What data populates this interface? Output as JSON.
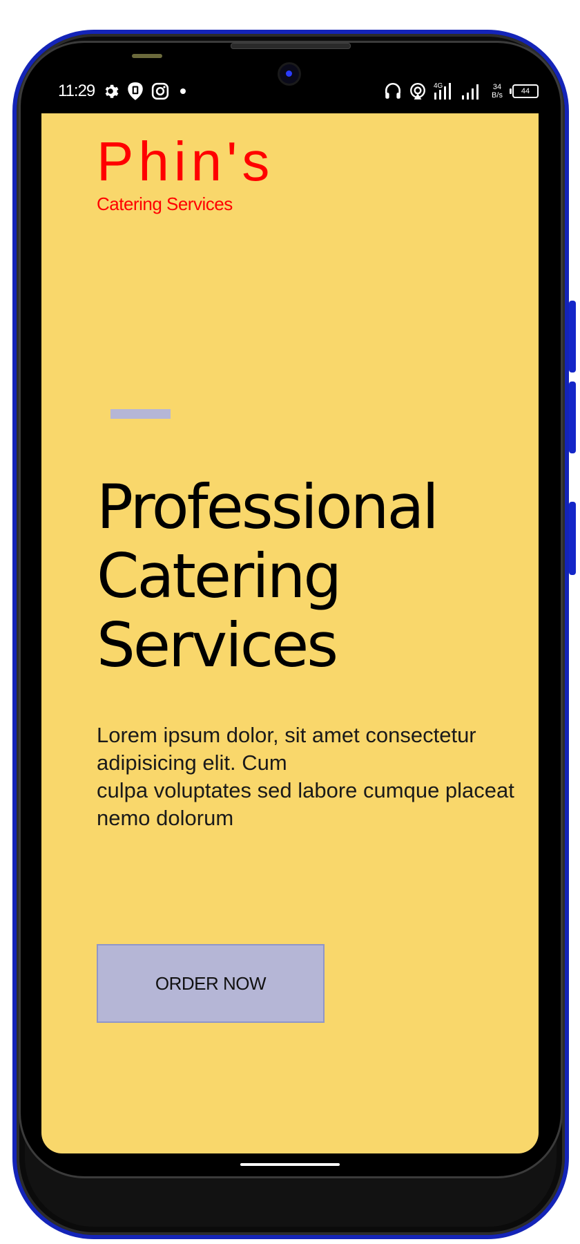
{
  "status_bar": {
    "time": "11:29",
    "network_type": "4G",
    "net_speed_value": "34",
    "net_speed_unit": "B/s",
    "battery_level": "44",
    "left_icons": [
      "gear-icon",
      "shield-notification-icon",
      "instagram-icon",
      "dot-icon"
    ],
    "right_icons": [
      "headphones-icon",
      "hotspot-icon",
      "signal-4g-icon",
      "signal-icon",
      "battery-icon"
    ]
  },
  "brand": {
    "name": "Phin's",
    "tagline": "Catering Services",
    "color": "#ff0000"
  },
  "hero": {
    "title": "Professional Catering Services",
    "body": "Lorem ipsum dolor, sit amet consectetur adipisicing elit. Cum\nculpa voluptates sed labore cumque placeat nemo dolorum",
    "cta_label": "ORDER NOW"
  },
  "colors": {
    "background": "#f9d76b",
    "accent": "#b5b6d6",
    "frame": "#1424b8",
    "text": "#000000"
  }
}
